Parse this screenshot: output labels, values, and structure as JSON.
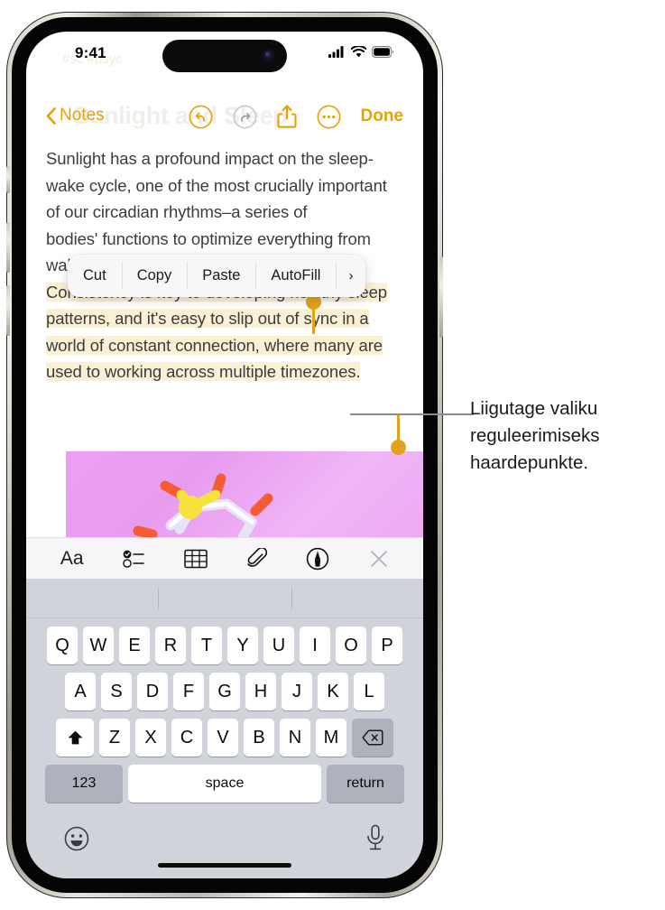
{
  "status_bar": {
    "time": "9:41",
    "icons": [
      "cellular-signal-icon",
      "wifi-icon",
      "battery-icon"
    ]
  },
  "ghost_header": {
    "tags": "#sc   #psyc",
    "title": "Sunlight and Sleep"
  },
  "nav_bar": {
    "back_label": "Notes",
    "back_icon": "chevron-left-icon",
    "undo_icon": "undo-icon",
    "redo_icon": "redo-icon",
    "share_icon": "share-icon",
    "more_icon": "more-ellipsis-icon",
    "done_label": "Done"
  },
  "note": {
    "paragraph_plain": "Sunlight has a profound impact on the sleep-wake cycle, one of the most crucially important of our circadian rhythms–a series of ",
    "paragraph_obscured": "bodies' functions to optimize everything from wakefulness to digestion. ",
    "selected_text": "Consistency is key to developing healthy sleep patterns, and it's easy to slip out of sync in a world of constant connection, where many are used to working across multiple timezones.",
    "highlight_color": "#faf0d4",
    "handle_color": "#E0A41A"
  },
  "context_menu": {
    "items": [
      {
        "label": "Cut",
        "name": "cut"
      },
      {
        "label": "Copy",
        "name": "copy"
      },
      {
        "label": "Paste",
        "name": "paste"
      },
      {
        "label": "AutoFill",
        "name": "autofill"
      }
    ],
    "more_chevron": "›"
  },
  "attachment": {
    "type": "image",
    "description": "molecule-illustration",
    "background_color": "#ec9ef2"
  },
  "format_toolbar": {
    "items": [
      {
        "name": "text-format-icon",
        "label": "Aa"
      },
      {
        "name": "checklist-icon",
        "label": ""
      },
      {
        "name": "table-icon",
        "label": ""
      },
      {
        "name": "attachment-paperclip-icon",
        "label": ""
      },
      {
        "name": "markup-pen-icon",
        "label": ""
      },
      {
        "name": "close-icon",
        "label": ""
      }
    ]
  },
  "keyboard": {
    "row1": [
      "Q",
      "W",
      "E",
      "R",
      "T",
      "Y",
      "U",
      "I",
      "O",
      "P"
    ],
    "row2": [
      "A",
      "S",
      "D",
      "F",
      "G",
      "H",
      "J",
      "K",
      "L"
    ],
    "row3": [
      "Z",
      "X",
      "C",
      "V",
      "B",
      "N",
      "M"
    ],
    "shift_icon": "shift-icon",
    "delete_icon": "delete-backspace-icon",
    "numeric_label": "123",
    "space_label": "space",
    "return_label": "return",
    "emoji_icon": "emoji-smiley-icon",
    "dictation_icon": "microphone-icon"
  },
  "callout": {
    "text": "Liigutage valiku reguleerimiseks haardepunkte."
  },
  "colors": {
    "accent": "#E8A200",
    "keyboard_bg": "#d1d3da",
    "toolbar_bg": "#f6f6f8"
  }
}
